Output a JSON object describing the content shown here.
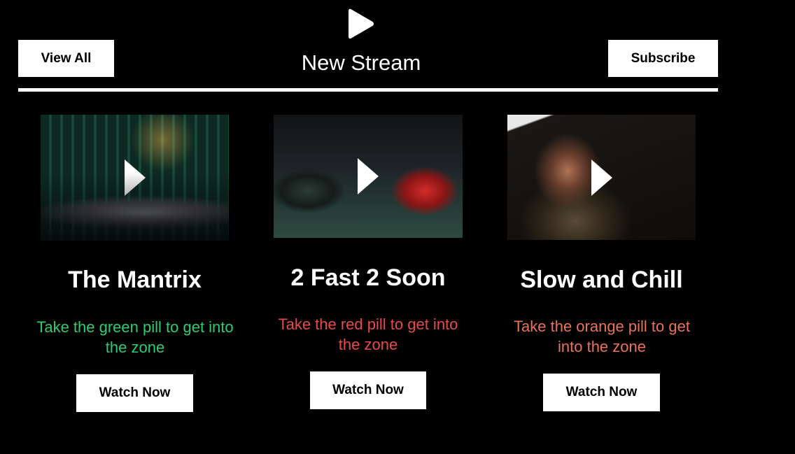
{
  "header": {
    "logo_icon": "play-icon",
    "title": "New Stream",
    "view_all_label": "View All",
    "subscribe_label": "Subscribe"
  },
  "cards": [
    {
      "title": "The Mantrix",
      "description": "Take the green pill to get into the zone",
      "description_color": "#2ecc71",
      "button_label": "Watch Now",
      "thumbnail_icon": "play-icon"
    },
    {
      "title": "2 Fast 2 Soon",
      "description": "Take the red pill to get into the zone",
      "description_color": "#e84a4a",
      "button_label": "Watch Now",
      "thumbnail_icon": "play-icon"
    },
    {
      "title": "Slow and Chill",
      "description": "Take the orange pill to get into the zone",
      "description_color": "#e8735a",
      "button_label": "Watch Now",
      "thumbnail_icon": "play-icon"
    }
  ],
  "colors": {
    "background": "#000000",
    "text": "#ffffff",
    "button_bg": "#ffffff",
    "button_text": "#000000"
  }
}
